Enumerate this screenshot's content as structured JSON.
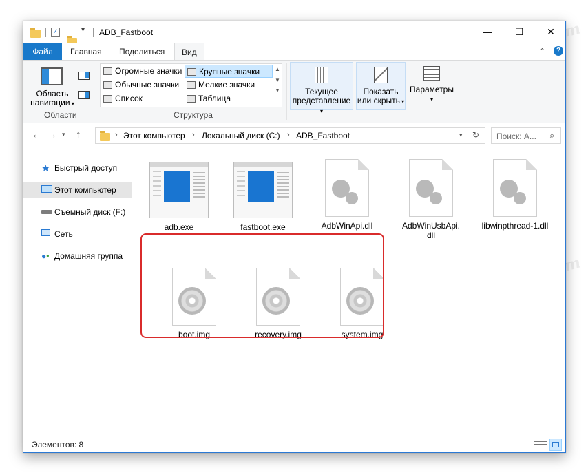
{
  "window": {
    "title": "ADB_Fastboot",
    "controls": {
      "minimize": "—",
      "maximize": "☐",
      "close": "✕"
    }
  },
  "ribbon_tabs": [
    {
      "label": "Файл"
    },
    {
      "label": "Главная"
    },
    {
      "label": "Поделиться"
    },
    {
      "label": "Вид"
    }
  ],
  "ribbon": {
    "areas_group_label": "Области",
    "nav_pane_label_1": "Область",
    "nav_pane_label_2": "навигации",
    "structure_group_label": "Структура",
    "layouts": [
      {
        "label": "Огромные значки"
      },
      {
        "label": "Крупные значки"
      },
      {
        "label": "Обычные значки"
      },
      {
        "label": "Мелкие значки"
      },
      {
        "label": "Список"
      },
      {
        "label": "Таблица"
      }
    ],
    "current_view_1": "Текущее",
    "current_view_2": "представление",
    "show_hide_1": "Показать",
    "show_hide_2": "или скрыть",
    "options": "Параметры"
  },
  "address": {
    "crumbs": [
      "Этот компьютер",
      "Локальный диск (C:)",
      "ADB_Fastboot"
    ],
    "search_placeholder": "Поиск: A..."
  },
  "nav_pane": [
    {
      "label": "Быстрый доступ",
      "icon": "star-icon"
    },
    {
      "label": "Этот компьютер",
      "icon": "computer-icon"
    },
    {
      "label": "Съемный диск (F:)",
      "icon": "drive-icon"
    },
    {
      "label": "Сеть",
      "icon": "network-icon"
    },
    {
      "label": "Домашняя группа",
      "icon": "homegroup-icon"
    }
  ],
  "files": [
    {
      "name": "adb.exe",
      "kind": "exe"
    },
    {
      "name": "fastboot.exe",
      "kind": "exe"
    },
    {
      "name": "AdbWinApi.dll",
      "kind": "dll"
    },
    {
      "name": "AdbWinUsbApi.dll",
      "kind": "dll"
    },
    {
      "name": "libwinpthread-1.dll",
      "kind": "dll"
    },
    {
      "name": "boot.img",
      "kind": "img"
    },
    {
      "name": "recovery.img",
      "kind": "img"
    },
    {
      "name": "system.img",
      "kind": "img"
    }
  ],
  "status": {
    "count": "Элементов: 8"
  },
  "watermark": "Soringpcrepair.Com",
  "colors": {
    "accent": "#1979ca",
    "highlight_border": "#d92b2b",
    "selected": "#cce8ff"
  }
}
